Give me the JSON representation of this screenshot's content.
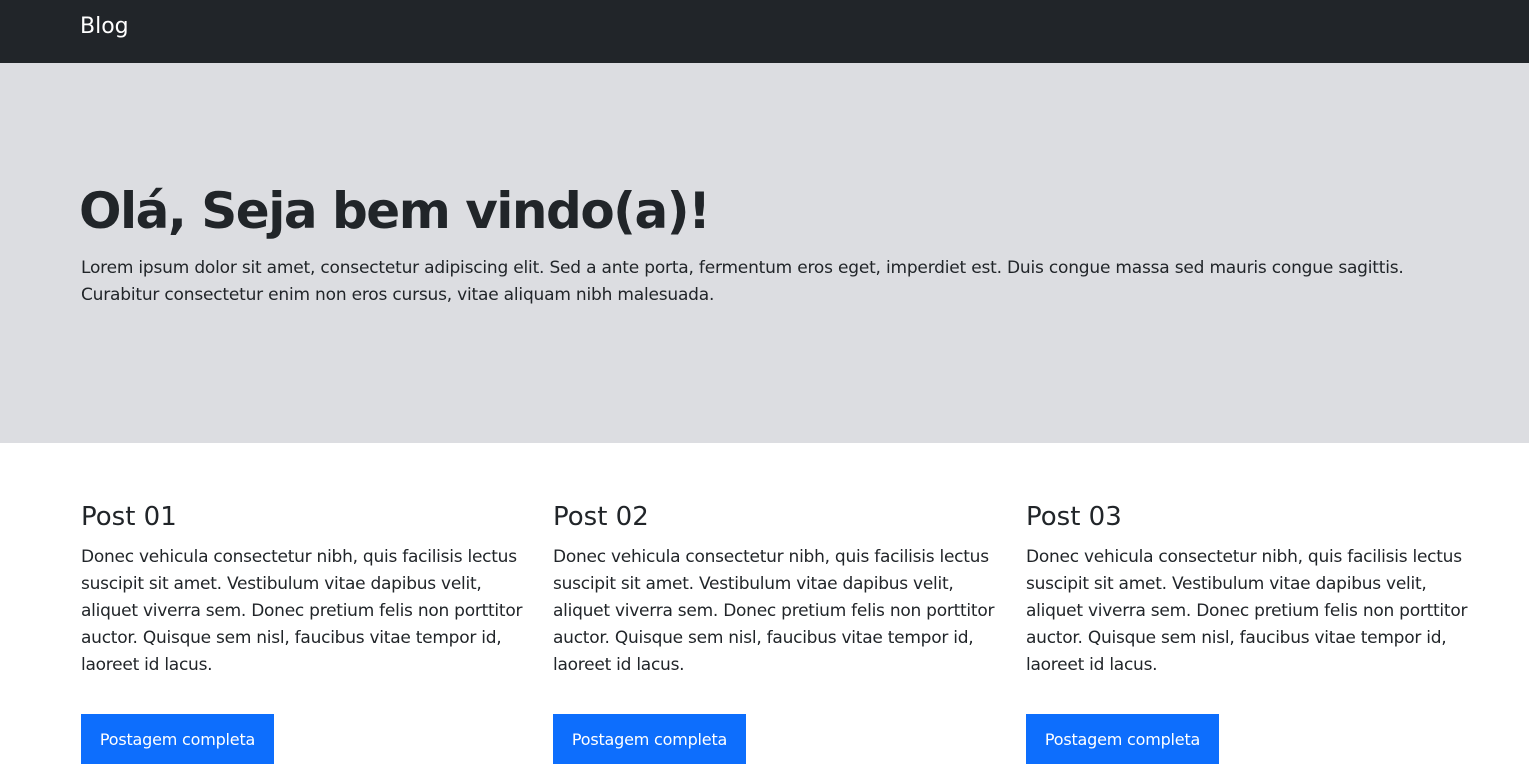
{
  "navbar": {
    "brand": "Blog"
  },
  "hero": {
    "title": "Olá, Seja bem vindo(a)!",
    "text": "Lorem ipsum dolor sit amet, consectetur adipiscing elit. Sed a ante porta, fermentum eros eget, imperdiet est. Duis congue massa sed mauris congue sagittis. Curabitur consectetur enim non eros cursus, vitae aliquam nibh malesuada."
  },
  "posts": [
    {
      "title": "Post 01",
      "text": "Donec vehicula consectetur nibh, quis facilisis lectus suscipit sit amet. Vestibulum vitae dapibus velit, aliquet viverra sem. Donec pretium felis non porttitor auctor. Quisque sem nisl, faucibus vitae tempor id, laoreet id lacus.",
      "button": "Postagem completa"
    },
    {
      "title": "Post 02",
      "text": "Donec vehicula consectetur nibh, quis facilisis lectus suscipit sit amet. Vestibulum vitae dapibus velit, aliquet viverra sem. Donec pretium felis non porttitor auctor. Quisque sem nisl, faucibus vitae tempor id, laoreet id lacus.",
      "button": "Postagem completa"
    },
    {
      "title": "Post 03",
      "text": "Donec vehicula consectetur nibh, quis facilisis lectus suscipit sit amet. Vestibulum vitae dapibus velit, aliquet viverra sem. Donec pretium felis non porttitor auctor. Quisque sem nisl, faucibus vitae tempor id, laoreet id lacus.",
      "button": "Postagem completa"
    }
  ],
  "colors": {
    "navbar_bg": "#212529",
    "hero_bg": "#dcdde1",
    "button_bg": "#0d6efd",
    "text": "#212529"
  }
}
